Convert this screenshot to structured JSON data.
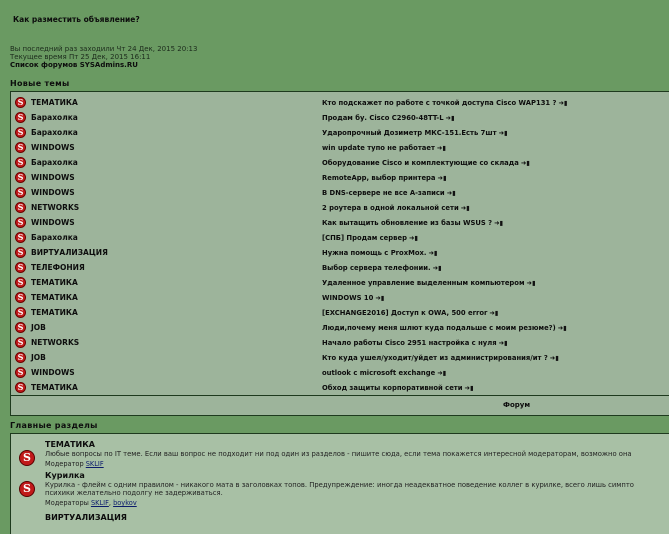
{
  "header": {
    "how_to_post": "Как разместить объявление?",
    "last_visit": "Вы последний раз заходили Чт 24 Дек, 2015 20:13",
    "current_time": "Текущее время Пт 25 Дек, 2015 16:11",
    "forum_list": "Список форумов SYSAdmins.RU"
  },
  "new_topics": {
    "title": "Новые темы",
    "rows": [
      {
        "category": "ТЕМАТИКА",
        "title": "Кто подскажет по работе с точкой доступа Cisco WAP131 ?"
      },
      {
        "category": "Барахолка",
        "title": "Продам бу. Cisco C2960-48TT-L"
      },
      {
        "category": "Барахолка",
        "title": "Ударопрочный Дозиметр МКС-151.Есть 7шт"
      },
      {
        "category": "WINDOWS",
        "title": "win update тупо не работает"
      },
      {
        "category": "Барахолка",
        "title": "Оборудование Cisco и комплектующие со склада"
      },
      {
        "category": "WINDOWS",
        "title": "RemoteApp, выбор принтера"
      },
      {
        "category": "WINDOWS",
        "title": "В DNS-сервере не все A-записи"
      },
      {
        "category": "NETWORKS",
        "title": "2 роутера в одной локальной сети"
      },
      {
        "category": "WINDOWS",
        "title": "Как вытащить обновление из базы WSUS ?"
      },
      {
        "category": "Барахолка",
        "title": "[СПБ] Продам сервер"
      },
      {
        "category": "ВИРТУАЛИЗАЦИЯ",
        "title": "Нужна помощь с ProxMox."
      },
      {
        "category": "ТЕЛЕФОНИЯ",
        "title": "Выбор сервера телефонии."
      },
      {
        "category": "ТЕМАТИКА",
        "title": "Удаленное управление выделенным компьютером"
      },
      {
        "category": "ТЕМАТИКА",
        "title": "WINDOWS 10"
      },
      {
        "category": "ТЕМАТИКА",
        "title": "[EXCHANGE2016] Доступ к OWA, 500 error"
      },
      {
        "category": "JOB",
        "title": "Люди,почему меня шлют куда подальше с моим резюме?)"
      },
      {
        "category": "NETWORKS",
        "title": "Начало работы Cisco 2951 настройка с нуля"
      },
      {
        "category": "JOB",
        "title": "Кто куда ушел/уходит/уйдет из администрирования/ит ?"
      },
      {
        "category": "WINDOWS",
        "title": "outlook с microsoft exchange"
      },
      {
        "category": "ТЕМАТИКА",
        "title": "Обход защиты корпоративной сети"
      }
    ],
    "forum_label": "Форум"
  },
  "main_sections": {
    "title": "Главные разделы",
    "items": [
      {
        "name": "ТЕМАТИКА",
        "desc1": "Любые вопросы по IT теме. Если ваш вопрос не подходит ни под один из разделов - пишите сюда, если тема покажется интересной модераторам, возможно она",
        "desc2": "",
        "mods_label": "Модератор",
        "mods": [
          "SKLIF"
        ]
      },
      {
        "name": "Курилка",
        "desc1": "Курилка - флейм с одним правилом - никакого мата в заголовках топов. Предупреждение: иногда неадекватное поведение коллег в курилке, всего лишь симпто",
        "desc2": "психики желательно подолгу не задерживаться.",
        "mods_label": "Модераторы",
        "mods": [
          "SKLIF",
          "boykov"
        ]
      },
      {
        "name": "ВИРТУАЛИЗАЦИЯ",
        "desc1": "",
        "desc2": "",
        "mods_label": "",
        "mods": []
      }
    ]
  },
  "icons": {
    "forum_icon": "s-circle-icon",
    "new_post": "goto-post-icon"
  },
  "colors": {
    "page_bg": "#6a9a62",
    "box_bg": "#9db49b",
    "icon_red": "#c11a1a"
  }
}
